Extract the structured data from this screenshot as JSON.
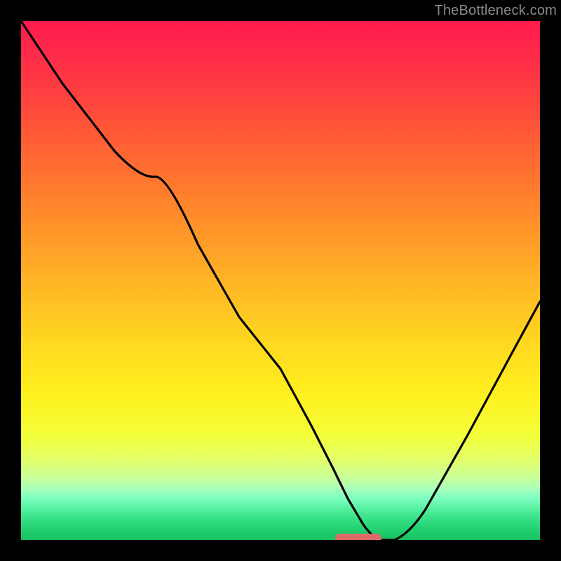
{
  "watermark": "TheBottleneck.com",
  "chart_data": {
    "type": "line",
    "title": "",
    "xlabel": "",
    "ylabel": "",
    "xlim": [
      0,
      100
    ],
    "ylim": [
      0,
      100
    ],
    "grid": false,
    "series": [
      {
        "name": "curve",
        "x": [
          0,
          8,
          18,
          26,
          34,
          42,
          50,
          56,
          60,
          63,
          66,
          69,
          72,
          78,
          86,
          94,
          100
        ],
        "y": [
          100,
          88,
          75,
          70,
          57,
          45,
          33,
          22,
          14,
          8,
          3,
          0,
          0,
          6,
          20,
          35,
          46
        ]
      }
    ],
    "marker": {
      "x_center": 65,
      "y": 0,
      "width": 9,
      "color": "#e06a6a"
    },
    "background_gradient": {
      "top": "#ff1a4d",
      "bottom": "#18c060"
    }
  }
}
